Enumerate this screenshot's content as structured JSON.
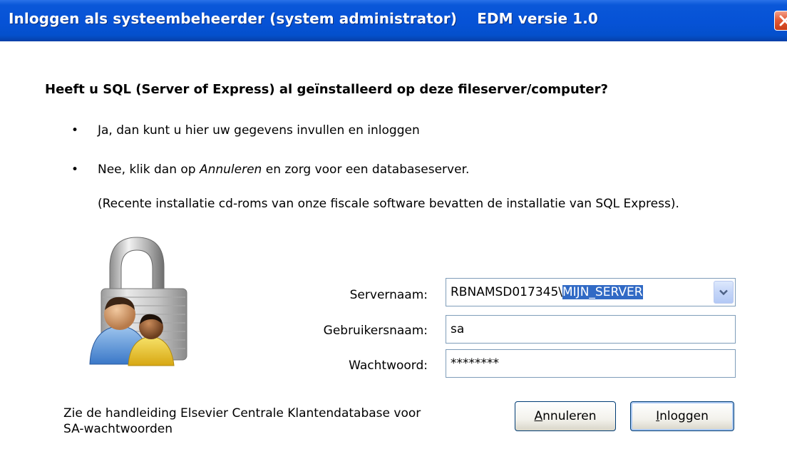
{
  "window": {
    "title": "Inloggen als systeembeheerder (system administrator)",
    "version": "EDM versie 1.0"
  },
  "question": "Heeft u SQL (Server of Express) al geïnstalleerd op deze fileserver/computer?",
  "bullets": {
    "yes": "Ja, dan kunt u hier uw gegevens invullen en inloggen",
    "no_prefix": "Nee, klik dan op ",
    "no_emph": "Annuleren",
    "no_suffix": " en zorg voor een databaseserver."
  },
  "note": "(Recente installatie cd-roms van onze fiscale software bevatten de installatie van SQL Express).",
  "form": {
    "server_label": "Servernaam:",
    "server_value_prefix": "RBNAMSD017345\\",
    "server_value_selected": "MIJN_SERVER",
    "user_label": "Gebruikersnaam:",
    "user_value": "sa",
    "password_label": "Wachtwoord:",
    "password_value": "********"
  },
  "footer_note": "Zie de handleiding Elsevier Centrale Klantendatabase voor SA-wachtwoorden",
  "buttons": {
    "cancel_mnemonic": "A",
    "cancel_rest": "nnuleren",
    "login_mnemonic": "I",
    "login_rest": "nloggen"
  },
  "icons": {
    "close": "close-icon",
    "padlock": "padlock-users-icon",
    "dropdown": "chevron-down-icon"
  }
}
